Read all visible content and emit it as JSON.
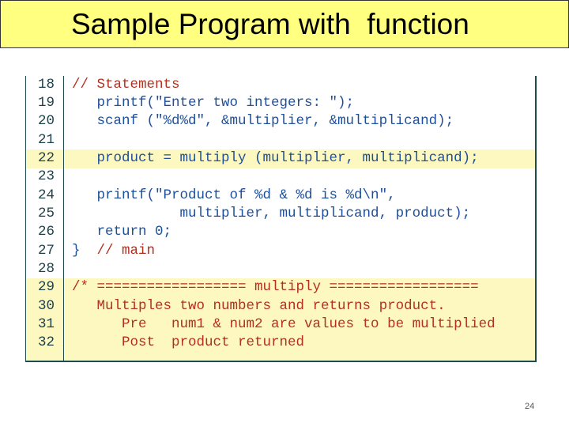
{
  "slide": {
    "title": "Sample Program with  function",
    "page_number": "24"
  },
  "colors": {
    "title_bg": "#ffff80",
    "code": "#1e4f9a",
    "comment": "#b2301f",
    "line_number": "#1d3f47",
    "highlight": "#fdf8c0"
  },
  "code": {
    "highlighted_lines": [
      22,
      29,
      30,
      31,
      32
    ],
    "lines": [
      {
        "n": "18",
        "segs": [
          {
            "t": "// Statements",
            "k": "comment"
          }
        ]
      },
      {
        "n": "19",
        "segs": [
          {
            "t": "   printf(\"Enter two integers: \");",
            "k": "code"
          }
        ]
      },
      {
        "n": "20",
        "segs": [
          {
            "t": "   scanf (\"%d%d\", &multiplier, &multiplicand);",
            "k": "code"
          }
        ]
      },
      {
        "n": "21",
        "segs": []
      },
      {
        "n": "22",
        "segs": [
          {
            "t": "   product = multiply (multiplier, multiplicand);",
            "k": "code"
          }
        ]
      },
      {
        "n": "23",
        "segs": []
      },
      {
        "n": "24",
        "segs": [
          {
            "t": "   printf(\"Product of %d & %d is %d\\n\",",
            "k": "code"
          }
        ]
      },
      {
        "n": "25",
        "segs": [
          {
            "t": "             multiplier, multiplicand, product);",
            "k": "code"
          }
        ]
      },
      {
        "n": "26",
        "segs": [
          {
            "t": "   return 0;",
            "k": "code"
          }
        ]
      },
      {
        "n": "27",
        "segs": [
          {
            "t": "}  ",
            "k": "code"
          },
          {
            "t": "// main",
            "k": "comment"
          }
        ]
      },
      {
        "n": "28",
        "segs": []
      },
      {
        "n": "29",
        "segs": [
          {
            "t": "/* ================== multiply ==================",
            "k": "comment"
          }
        ]
      },
      {
        "n": "30",
        "segs": [
          {
            "t": "   Multiples two numbers and returns product.",
            "k": "comment"
          }
        ]
      },
      {
        "n": "31",
        "segs": [
          {
            "t": "      Pre   num1 & num2 are values to be multiplied",
            "k": "comment"
          }
        ]
      },
      {
        "n": "32",
        "segs": [
          {
            "t": "      Post  product returned",
            "k": "comment"
          }
        ]
      }
    ]
  }
}
